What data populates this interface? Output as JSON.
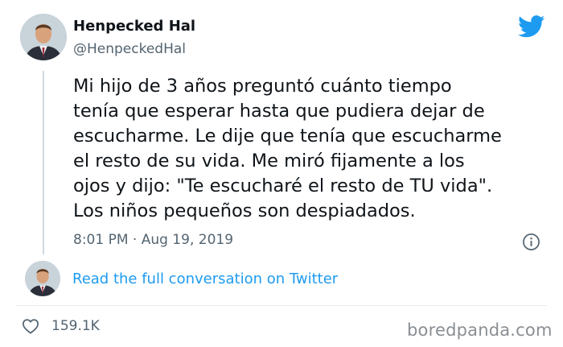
{
  "tweet": {
    "author": {
      "display_name": "Henpecked Hal",
      "handle": "@HenpeckedHal"
    },
    "text": "Mi hijo de 3 años preguntó cuánto tiempo\ntenía que esperar hasta que pudiera dejar de\nescucharme. Le dije que tenía que escucharme\nel resto de su vida. Me miró fijamente a los\nojos y dijo: \"Te escucharé el resto de TU vida\".\nLos niños pequeños son despiadados.",
    "timestamp": "8:01 PM · Aug 19, 2019",
    "likes": "159.1K"
  },
  "conversation_link": "Read the full conversation on Twitter",
  "watermark": "boredpanda.com",
  "colors": {
    "twitter_blue": "#1d9bf0",
    "secondary_text": "#536471",
    "primary_text": "#0f1419"
  },
  "icons": {
    "brand": "twitter-bird-icon",
    "info": "info-icon",
    "like": "heart-icon"
  }
}
